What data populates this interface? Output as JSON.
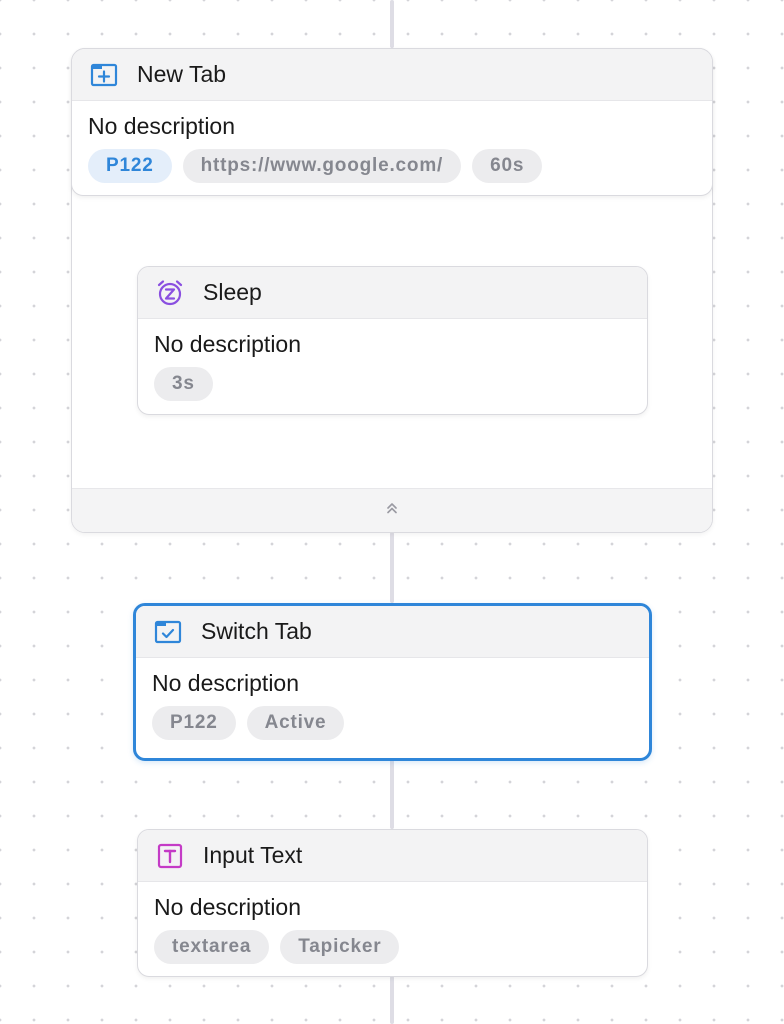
{
  "nodes": {
    "new_tab": {
      "title": "New Tab",
      "description": "No description",
      "icon": "new-tab-icon",
      "tags": [
        "P122",
        "https://www.google.com/",
        "60s"
      ]
    },
    "sleep": {
      "title": "Sleep",
      "description": "No description",
      "icon": "sleep-icon",
      "tags": [
        "3s"
      ]
    },
    "switch_tab": {
      "title": "Switch Tab",
      "description": "No description",
      "icon": "switch-tab-icon",
      "selected": true,
      "tags": [
        "P122",
        "Active"
      ]
    },
    "input_text": {
      "title": "Input Text",
      "description": "No description",
      "icon": "input-text-icon",
      "tags": [
        "textarea",
        "Tapicker"
      ]
    }
  },
  "colors": {
    "accent": "#2f86d9",
    "sleep_icon": "#8a4fe0",
    "input_icon": "#c43bc6",
    "connector": "#dedde5",
    "tag_text": "#85878f"
  }
}
